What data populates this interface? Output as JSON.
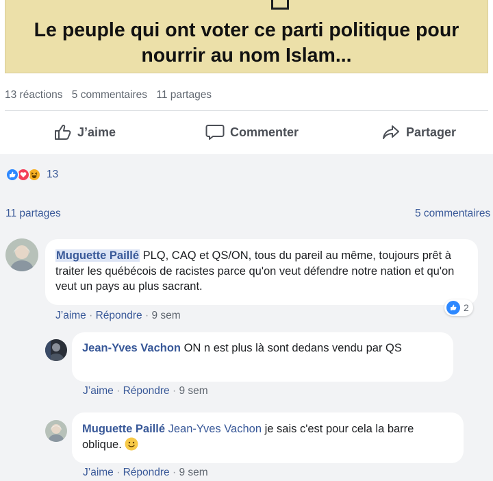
{
  "post": {
    "title": "Le peuple qui ont voter ce parti politique pour nourrir au nom Islam...",
    "stats": {
      "reactions": "13 réactions",
      "comments": "5 commentaires",
      "shares": "11 partages"
    }
  },
  "actions": {
    "like": "J’aime",
    "comment": "Commenter",
    "share": "Partager"
  },
  "reactions_bar": {
    "count": "13",
    "icons": [
      "like-icon",
      "love-icon",
      "haha-icon"
    ],
    "colors": {
      "like": "#2d88ff",
      "love": "#f33e58",
      "haha": "#f7b125"
    }
  },
  "links": {
    "shares": "11 partages",
    "comments": "5 commentaires"
  },
  "comments": [
    {
      "author": "Muguette Paillé",
      "text": "PLQ, CAQ et QS/ON, tous du pareil au même, toujours prêt à traiter les québécois de racistes parce qu'on veut défendre notre nation et qu'on veut un pays au plus sacrant.",
      "like": "J’aime",
      "reply": "Répondre",
      "time": "9 sem",
      "likes": "2"
    },
    {
      "author": "Jean-Yves Vachon",
      "text": "ON n est plus là sont dedans vendu par QS",
      "like": "J’aime",
      "reply": "Répondre",
      "time": "9 sem"
    },
    {
      "author": "Muguette Paillé",
      "mention": "Jean-Yves Vachon",
      "text": "je sais c'est pour cela la barre oblique.",
      "emoji": "smile-emoji",
      "like": "J’aime",
      "reply": "Répondre",
      "time": "9 sem"
    }
  ]
}
